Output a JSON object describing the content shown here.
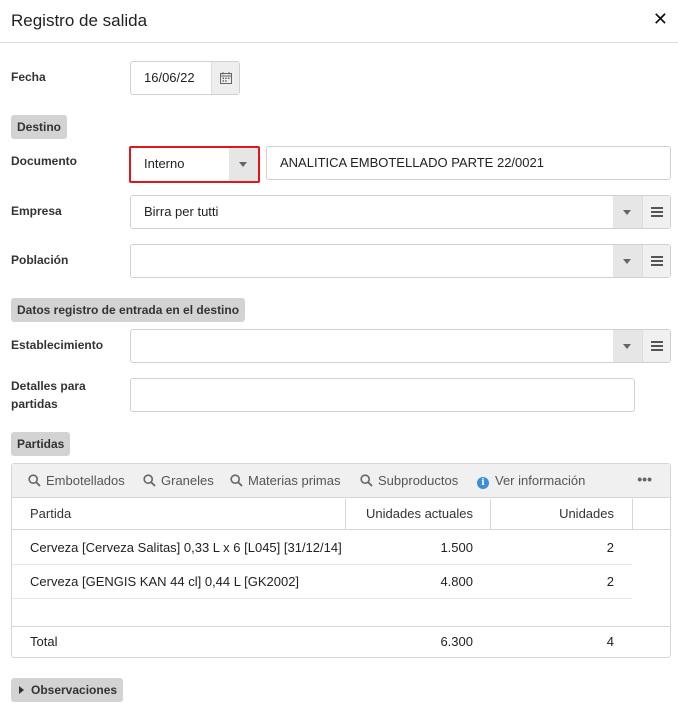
{
  "dialog": {
    "title": "Registro de salida",
    "close_glyph": "✕"
  },
  "fecha": {
    "label": "Fecha",
    "value": "16/06/22",
    "icon": "calendar-icon"
  },
  "sections": {
    "destino": "Destino",
    "datos_entrada": "Datos registro de entrada en el destino",
    "partidas": "Partidas",
    "observaciones": "Observaciones"
  },
  "documento": {
    "label": "Documento",
    "type_value": "Interno",
    "text_value": "ANALITICA EMBOTELLADO PARTE 22/0021",
    "highlight_color": "#e0161b"
  },
  "empresa": {
    "label": "Empresa",
    "value": "Birra per tutti"
  },
  "poblacion": {
    "label": "Población",
    "value": ""
  },
  "establecimiento": {
    "label": "Establecimiento",
    "value": ""
  },
  "detalles": {
    "label_line1": "Detalles para",
    "label_line2": "partidas",
    "value": ""
  },
  "grid": {
    "toolbar": {
      "embotellados": "Embotellados",
      "graneles": "Graneles",
      "materias_primas": "Materias primas",
      "subproductos": "Subproductos",
      "ver_informacion": "Ver información",
      "more": "•••"
    },
    "columns": {
      "partida": "Partida",
      "unidades_actuales": "Unidades actuales",
      "unidades": "Unidades"
    },
    "rows": [
      {
        "partida": "Cerveza [Cerveza Salitas] 0,33 L x 6 [L045] [31/12/14]",
        "unidades_actuales": "1.500",
        "unidades": "2"
      },
      {
        "partida": "Cerveza [GENGIS KAN 44 cl] 0,44 L [GK2002]",
        "unidades_actuales": "4.800",
        "unidades": "2"
      }
    ],
    "footer": {
      "label": "Total",
      "unidades_actuales": "6.300",
      "unidades": "4"
    }
  },
  "colors": {
    "accent_info": "#3b8fd6",
    "section_bg": "#d3d3d3",
    "highlight": "#e0161b"
  }
}
